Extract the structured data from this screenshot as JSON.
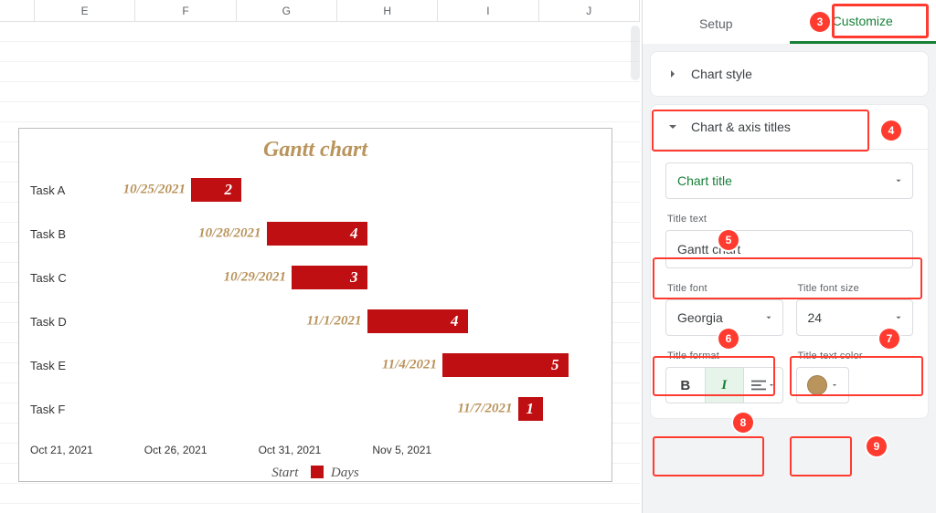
{
  "columns": [
    "E",
    "F",
    "G",
    "H",
    "I",
    "J"
  ],
  "chart": {
    "title": "Gantt chart",
    "title_color": "#b9945c",
    "bar_color": "#bf0f12",
    "legend": {
      "start": "Start",
      "days": "Days"
    },
    "xaxis": [
      "Oct 21, 2021",
      "Oct 26, 2021",
      "Oct 31, 2021",
      "Nov 5, 2021",
      ""
    ],
    "tasks": [
      {
        "name": "Task A",
        "start": "10/25/2021",
        "days": 2
      },
      {
        "name": "Task B",
        "start": "10/28/2021",
        "days": 4
      },
      {
        "name": "Task C",
        "start": "10/29/2021",
        "days": 3
      },
      {
        "name": "Task D",
        "start": "11/1/2021",
        "days": 4
      },
      {
        "name": "Task E",
        "start": "11/4/2021",
        "days": 5
      },
      {
        "name": "Task F",
        "start": "11/7/2021",
        "days": 1
      }
    ]
  },
  "chart_data": {
    "type": "bar",
    "orientation": "horizontal-stacked",
    "title": "Gantt chart",
    "xlabel": "",
    "ylabel": "",
    "x_ticks": [
      "Oct 21, 2021",
      "Oct 26, 2021",
      "Oct 31, 2021",
      "Nov 5, 2021"
    ],
    "categories": [
      "Task A",
      "Task B",
      "Task C",
      "Task D",
      "Task E",
      "Task F"
    ],
    "series": [
      {
        "name": "Start",
        "type": "offset",
        "values": [
          "10/25/2021",
          "10/28/2021",
          "10/29/2021",
          "11/1/2021",
          "11/4/2021",
          "11/7/2021"
        ]
      },
      {
        "name": "Days",
        "type": "bar",
        "values": [
          2,
          4,
          3,
          4,
          5,
          1
        ]
      }
    ],
    "x_range": [
      "10/21/2021",
      "11/10/2021"
    ],
    "legend_position": "bottom"
  },
  "panel": {
    "tabs": {
      "setup": "Setup",
      "customize": "Customize"
    },
    "sections": {
      "chart_style": "Chart style",
      "chart_axis_titles": "Chart & axis titles"
    },
    "selector": {
      "value": "Chart title"
    },
    "title_text_label": "Title text",
    "title_text_value": "Gantt chart",
    "title_font_label": "Title font",
    "title_font_value": "Georgia",
    "title_font_size_label": "Title font size",
    "title_font_size_value": "24",
    "title_format_label": "Title format",
    "title_text_color_label": "Title text color",
    "title_text_color_value": "#b9945c",
    "format_bold": "B",
    "format_italic": "I"
  },
  "callouts": [
    "3",
    "4",
    "5",
    "6",
    "7",
    "8",
    "9"
  ]
}
